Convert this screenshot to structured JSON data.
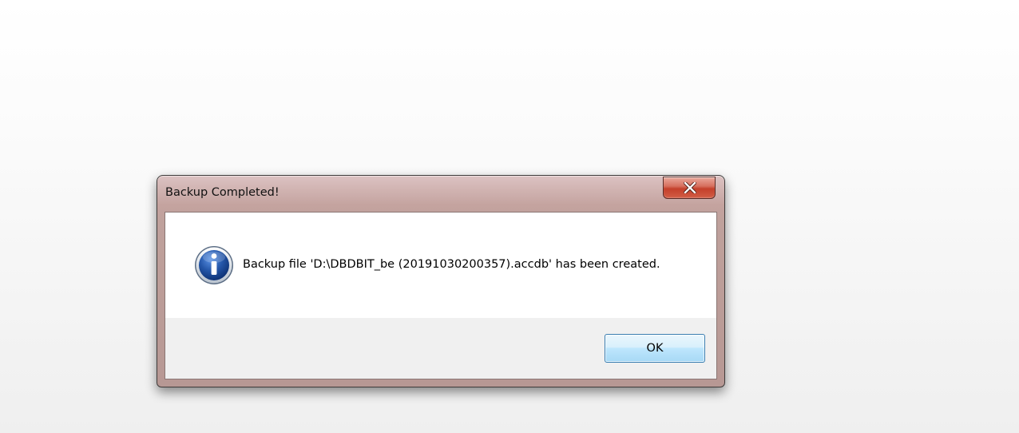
{
  "dialog": {
    "title": "Backup Completed!",
    "close_icon": "close-x-icon",
    "message_icon": "info-icon",
    "message": "Backup file 'D:\\DBDBIT_be (20191030200357).accdb' has been created.",
    "ok_label": "OK"
  },
  "colors": {
    "frame": "#bfa19c",
    "close_button": "#c4402b",
    "ok_button_border": "#3c7fb1",
    "info_icon": "#2456a8"
  }
}
